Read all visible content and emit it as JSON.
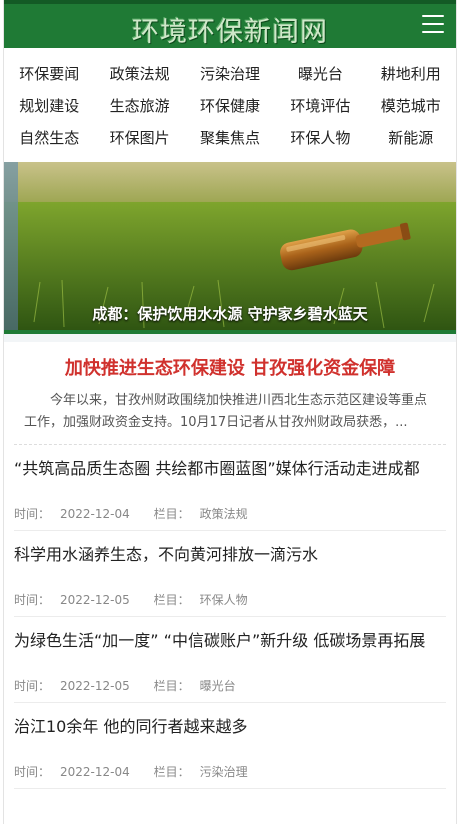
{
  "site": {
    "logo_text": "环境环保新闻网",
    "menu_icon": "hamburger-menu-icon",
    "brand_color": "#1f7a35"
  },
  "nav": {
    "items": [
      "环保要闻",
      "政策法规",
      "污染治理",
      "曝光台",
      "耕地利用",
      "规划建设",
      "生态旅游",
      "环保健康",
      "环境评估",
      "模范城市",
      "自然生态",
      "环保图片",
      "聚集焦点",
      "环保人物",
      "新能源"
    ]
  },
  "hero": {
    "caption": "成都：保护饮用水水源 守护家乡碧水蓝天"
  },
  "feature": {
    "title": "加快推进生态环保建设 甘孜强化资金保障",
    "summary": "今年以来，甘孜州财政围绕加快推进川西北生态示范区建设等重点工作，加强财政资金支持。10月17日记者从甘孜州财政局获悉，..."
  },
  "news": {
    "time_label": "时间：",
    "column_label": "栏目：",
    "items": [
      {
        "title": "“共筑高品质生态圈 共绘都市圈蓝图”媒体行活动走进成都",
        "date": "2022-12-04",
        "column": "政策法规"
      },
      {
        "title": "科学用水涵养生态，不向黄河排放一滴污水",
        "date": "2022-12-05",
        "column": "环保人物"
      },
      {
        "title": "为绿色生活“加一度” “中信碳账户”新升级 低碳场景再拓展",
        "date": "2022-12-05",
        "column": "曝光台"
      },
      {
        "title": "治江10余年 他的同行者越来越多",
        "date": "2022-12-04",
        "column": "污染治理"
      }
    ]
  }
}
